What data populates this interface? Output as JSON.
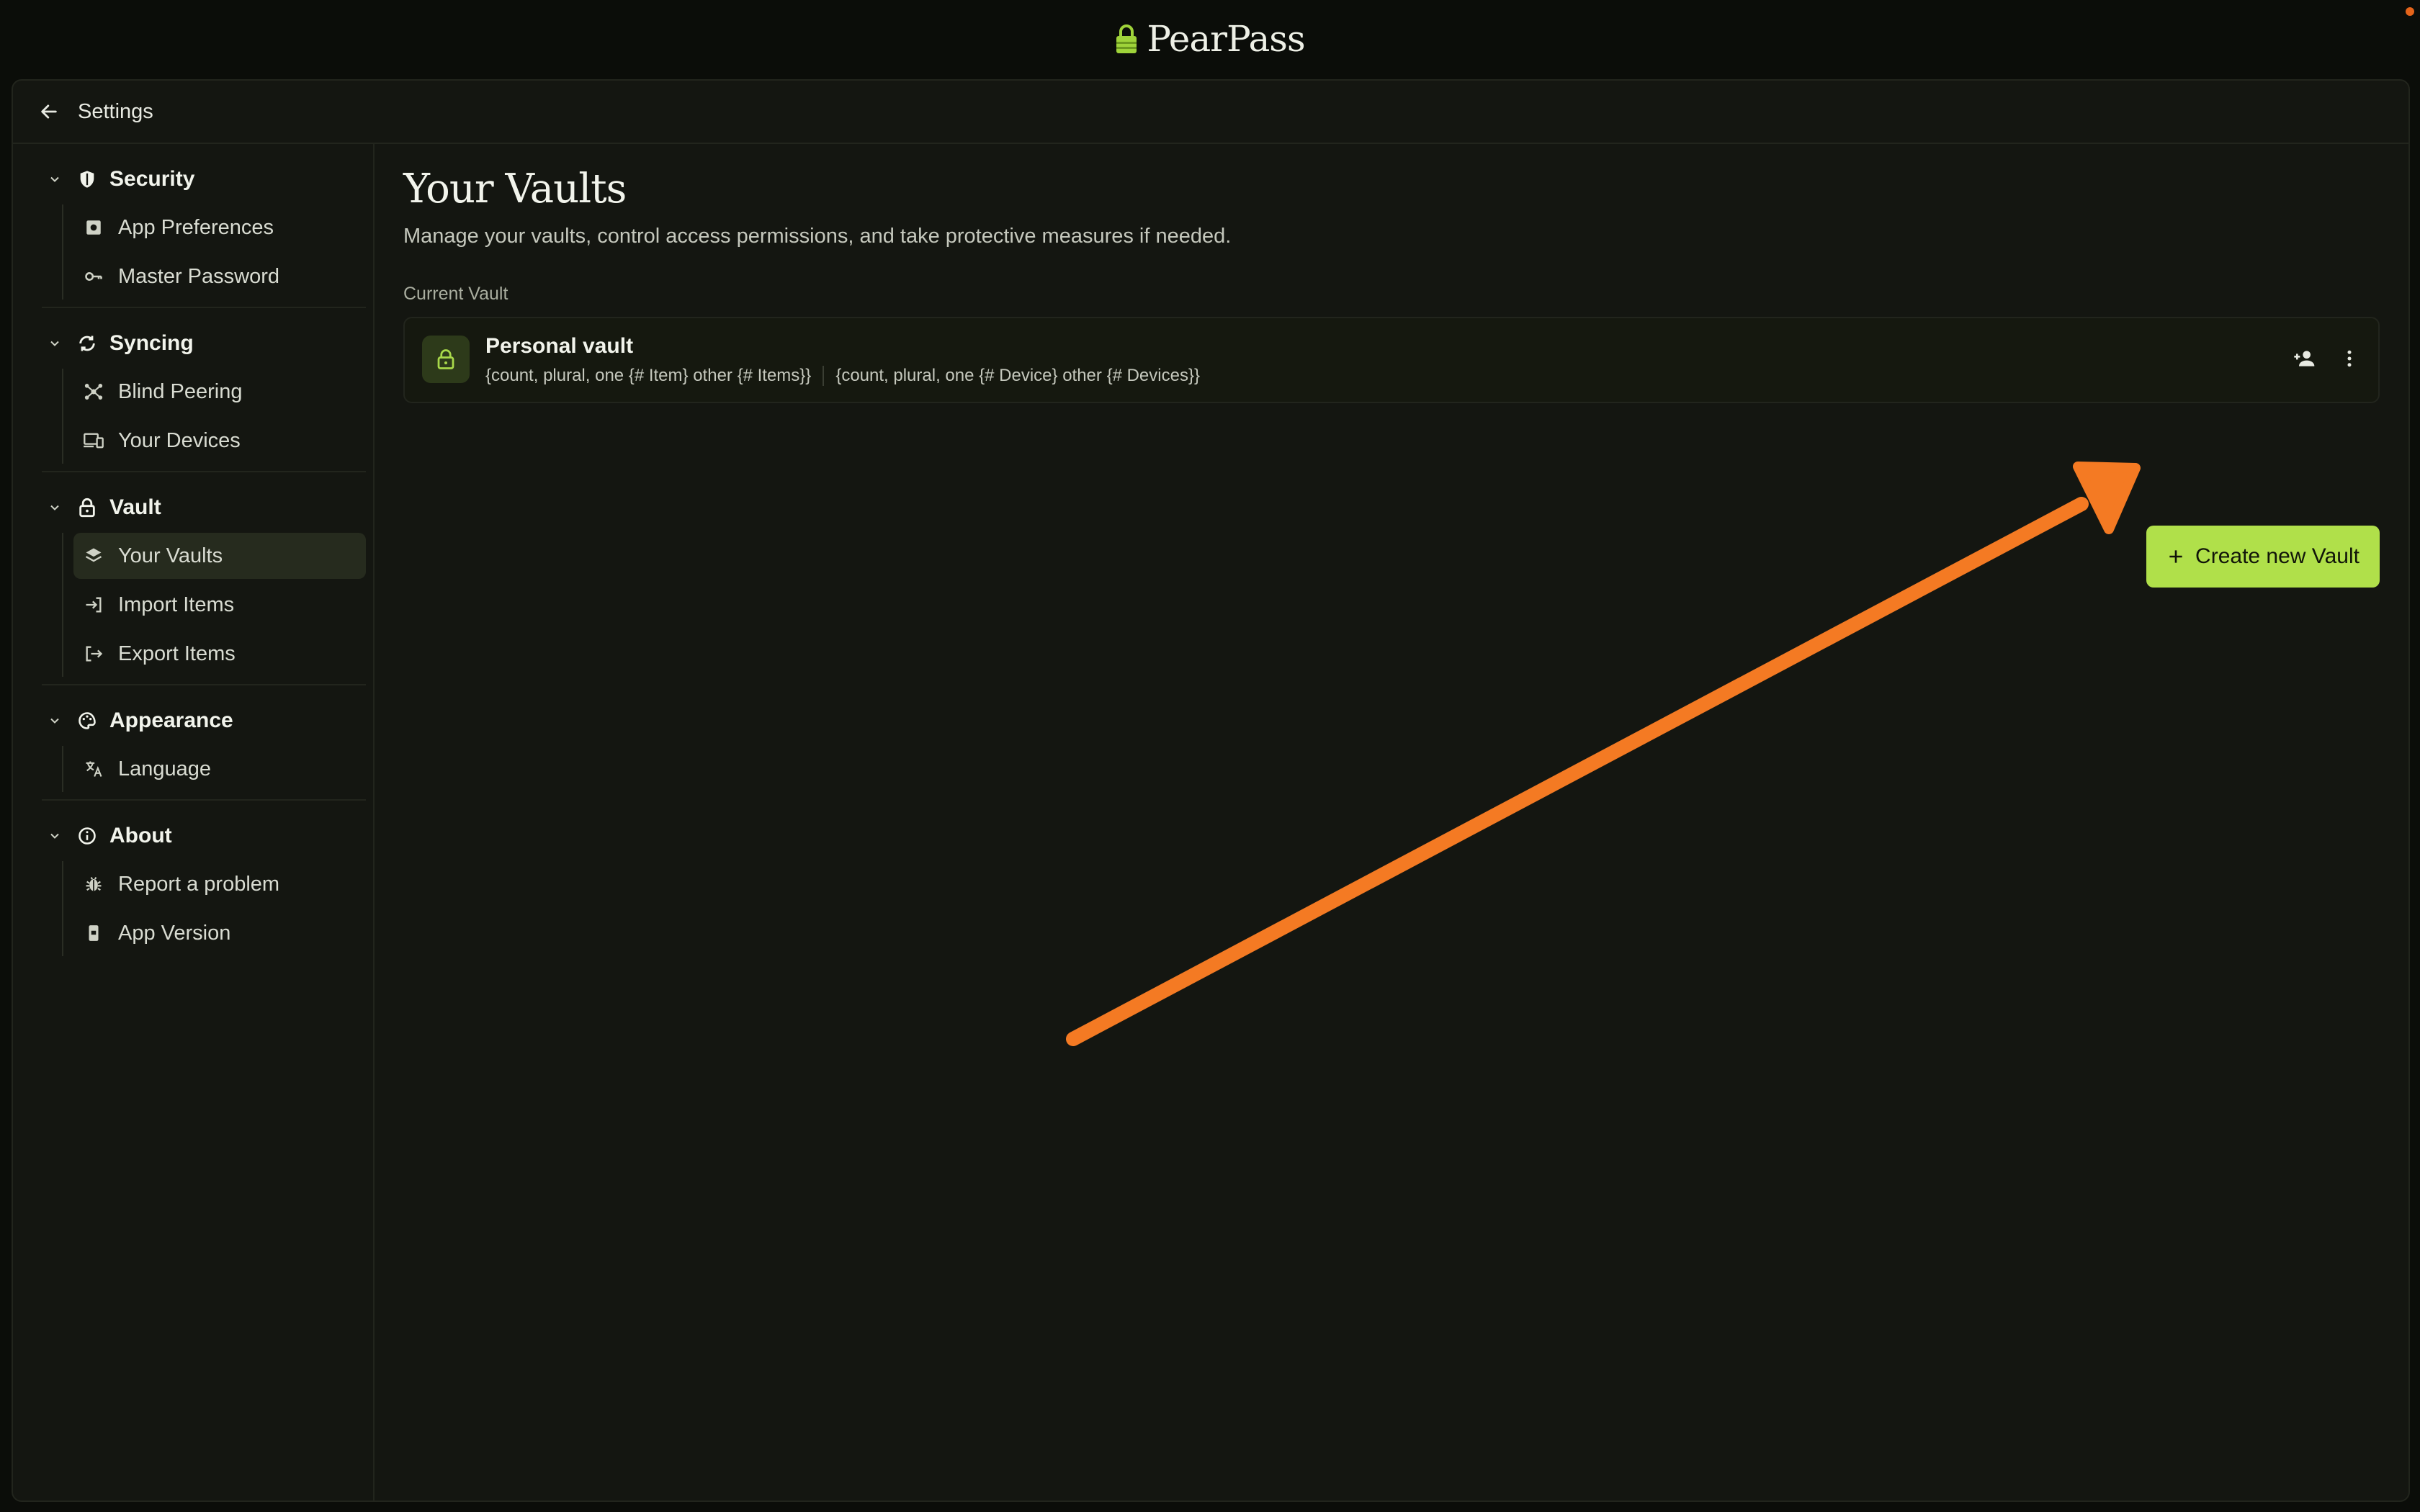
{
  "app": {
    "name": "PearPass"
  },
  "header": {
    "title": "Settings"
  },
  "sidebar": {
    "sections": [
      {
        "label": "Security",
        "items": [
          {
            "label": "App Preferences"
          },
          {
            "label": "Master Password"
          }
        ]
      },
      {
        "label": "Syncing",
        "items": [
          {
            "label": "Blind Peering"
          },
          {
            "label": "Your Devices"
          }
        ]
      },
      {
        "label": "Vault",
        "items": [
          {
            "label": "Your Vaults"
          },
          {
            "label": "Import Items"
          },
          {
            "label": "Export Items"
          }
        ]
      },
      {
        "label": "Appearance",
        "items": [
          {
            "label": "Language"
          }
        ]
      },
      {
        "label": "About",
        "items": [
          {
            "label": "Report a problem"
          },
          {
            "label": "App Version"
          }
        ]
      }
    ]
  },
  "main": {
    "title": "Your Vaults",
    "subtitle": "Manage your vaults, control access permissions, and take protective measures if needed.",
    "current_vault_label": "Current Vault",
    "vault": {
      "name": "Personal vault",
      "items_text": "{count, plural, one {# Item} other {# Items}}",
      "devices_text": "{count, plural, one {# Device} other {# Devices}}"
    },
    "create_button_label": "Create new Vault"
  },
  "colors": {
    "accent": "#b0e04a",
    "annotation": "#f47a23",
    "background": "#141611"
  }
}
